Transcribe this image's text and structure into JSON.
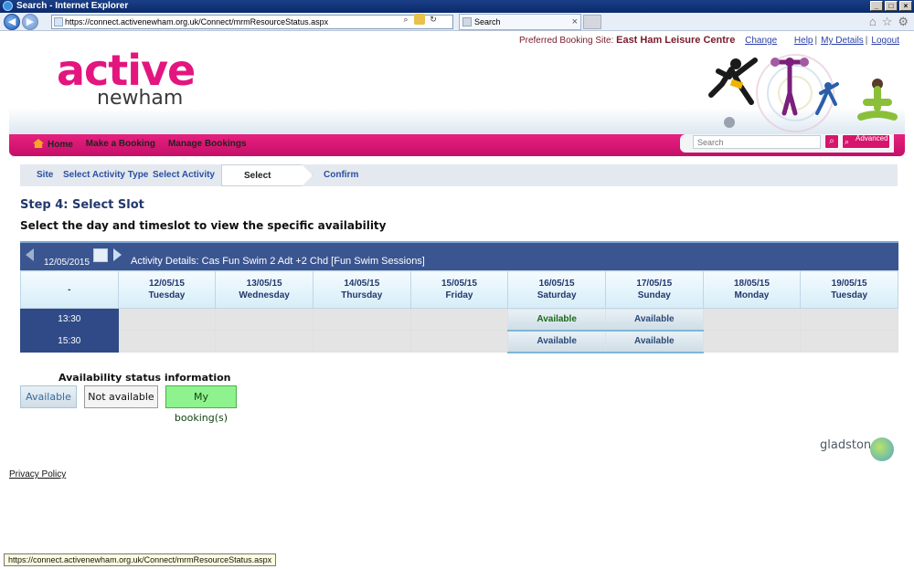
{
  "browser": {
    "title": "Search - Internet Explorer",
    "url": "https://connect.activenewham.org.uk/Connect/mrmResourceStatus.aspx",
    "tab_label": "Search",
    "status_url": "https://connect.activenewham.org.uk/Connect/mrmResourceStatus.aspx"
  },
  "header": {
    "preferred_label": "Preferred Booking Site:",
    "preferred_site": "East Ham Leisure Centre",
    "change": "Change",
    "help": "Help",
    "my_details": "My Details",
    "logout": "Logout",
    "logo_top": "active",
    "logo_bottom": "newham"
  },
  "menu": {
    "home": "Home",
    "make_booking": "Make a Booking",
    "manage_bookings": "Manage Bookings",
    "search_placeholder": "Search",
    "advanced": "Advanced"
  },
  "steps": [
    "Site",
    "Select Activity Type",
    "Select Activity",
    "Select Slot",
    "Confirm"
  ],
  "page": {
    "step_title": "Step 4: Select Slot",
    "subtitle": "Select the day and timeslot to view the specific availability"
  },
  "activity": {
    "date": "12/05/2015",
    "details": "Activity Details: Cas Fun Swim 2 Adt +2 Chd [Fun Swim Sessions]"
  },
  "grid": {
    "corner": "-",
    "days": [
      {
        "date": "12/05/15",
        "day": "Tuesday"
      },
      {
        "date": "13/05/15",
        "day": "Wednesday"
      },
      {
        "date": "14/05/15",
        "day": "Thursday"
      },
      {
        "date": "15/05/15",
        "day": "Friday"
      },
      {
        "date": "16/05/15",
        "day": "Saturday"
      },
      {
        "date": "17/05/15",
        "day": "Sunday"
      },
      {
        "date": "18/05/15",
        "day": "Monday"
      },
      {
        "date": "19/05/15",
        "day": "Tuesday"
      }
    ],
    "rows": [
      {
        "time": "13:30",
        "cells": [
          "",
          "",
          "",
          "",
          "Available",
          "Available",
          "",
          ""
        ]
      },
      {
        "time": "15:30",
        "cells": [
          "",
          "",
          "",
          "",
          "Available",
          "Available",
          "",
          ""
        ]
      }
    ]
  },
  "legend": {
    "title": "Availability status information",
    "available": "Available",
    "not_available": "Not available",
    "my_bookings": "My booking(s)"
  },
  "footer": {
    "brand": "gladstone",
    "privacy": "Privacy Policy"
  },
  "colors": {
    "brand_magenta": "#e3157f",
    "nav_blue": "#3a5590",
    "time_blue": "#2f4a86"
  }
}
